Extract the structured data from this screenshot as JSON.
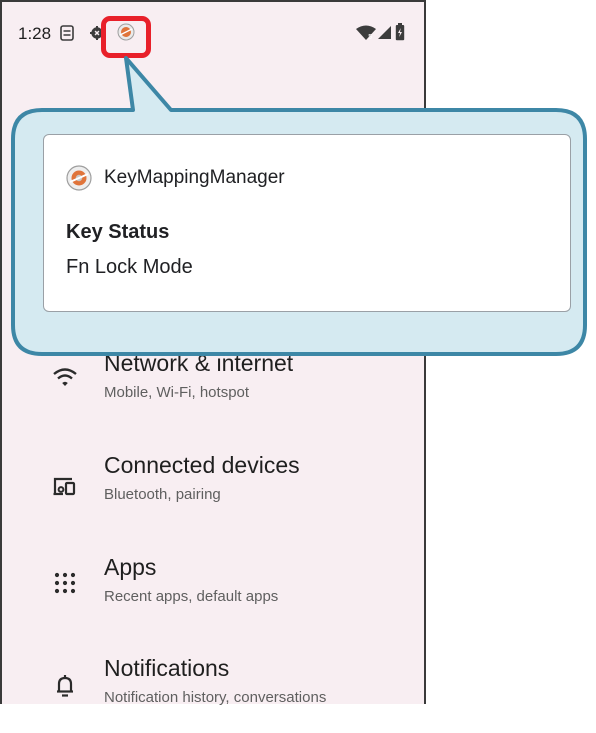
{
  "status_bar": {
    "time": "1:28",
    "icons": [
      "sim-status-icon",
      "settings-gear-icon",
      "keymapping-app-icon",
      "wifi-icon",
      "cellular-signal-icon",
      "battery-icon"
    ]
  },
  "notification": {
    "app_name": "KeyMappingManager",
    "title": "Key Status",
    "text": "Fn Lock Mode"
  },
  "settings": {
    "items": [
      {
        "title": "Network & internet",
        "subtitle": "Mobile, Wi‑Fi, hotspot",
        "icon": "wifi-icon"
      },
      {
        "title": "Connected devices",
        "subtitle": "Bluetooth, pairing",
        "icon": "devices-icon"
      },
      {
        "title": "Apps",
        "subtitle": "Recent apps, default apps",
        "icon": "apps-grid-icon"
      },
      {
        "title": "Notifications",
        "subtitle": "Notification history, conversations",
        "icon": "bell-icon"
      }
    ]
  },
  "colors": {
    "highlight": "#e8202a",
    "callout_fill": "#d5eaf1",
    "callout_stroke": "#3d87a6",
    "screen_bg": "#f8eef2"
  }
}
